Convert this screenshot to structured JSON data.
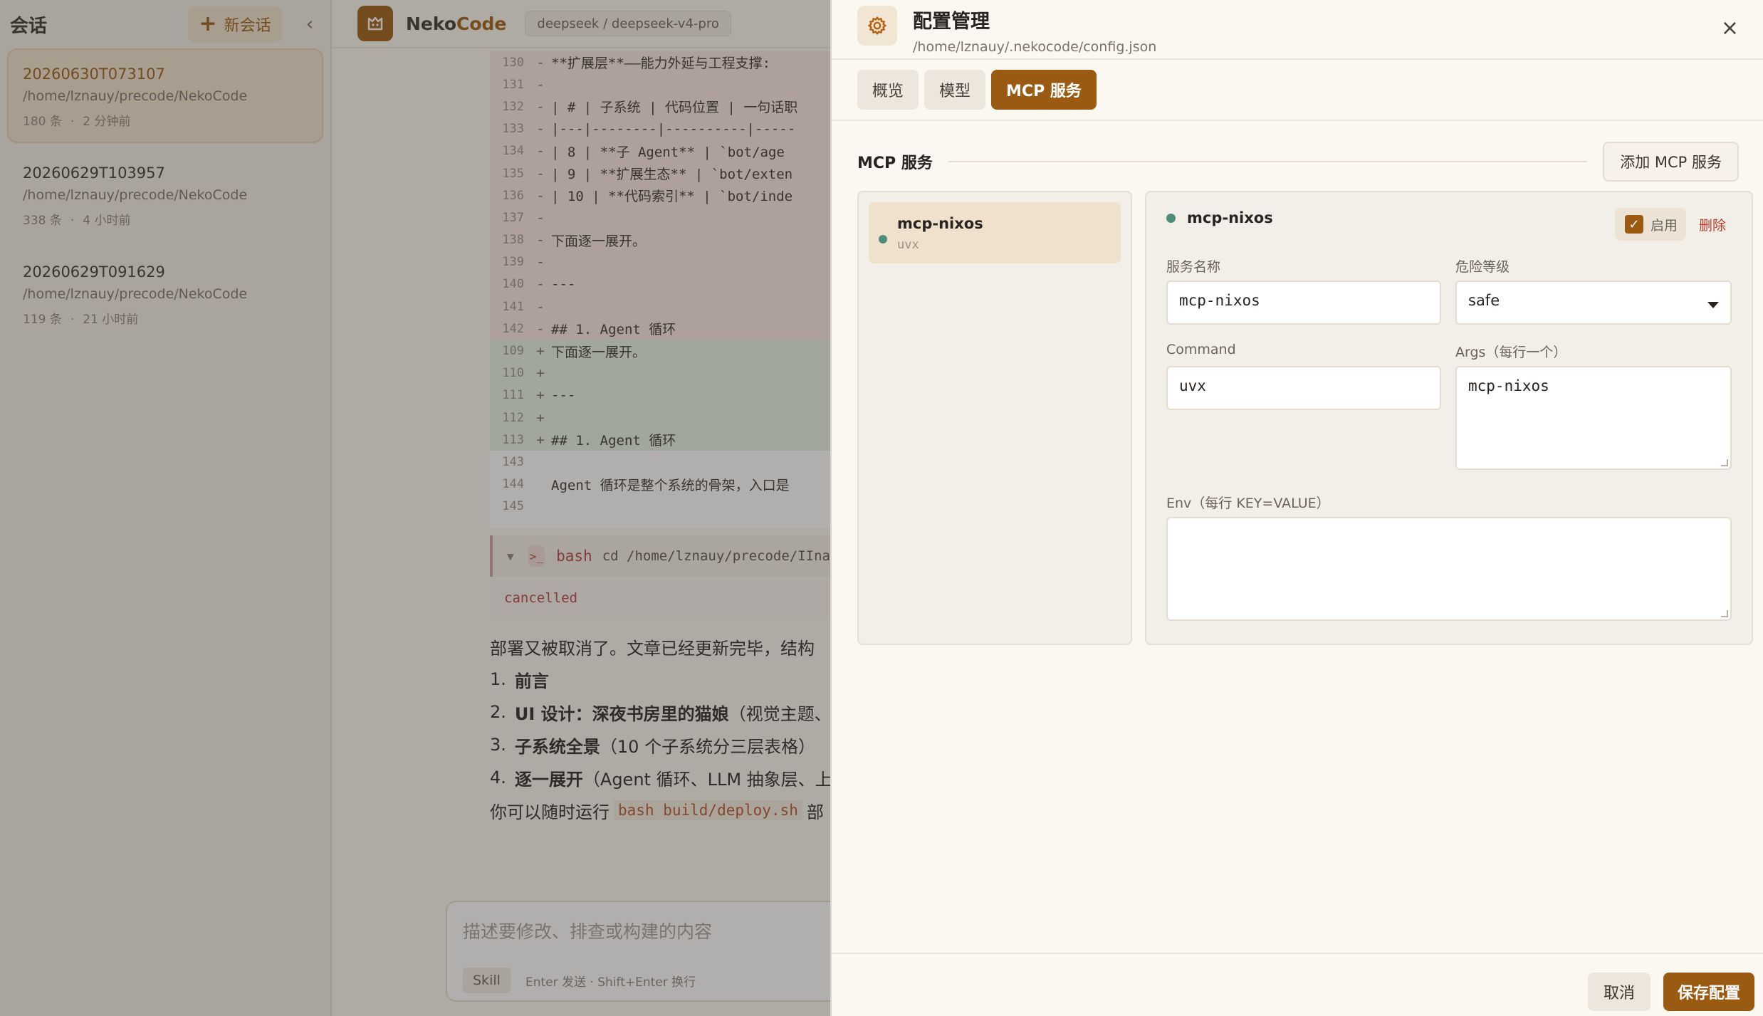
{
  "sidebar": {
    "title": "会话",
    "new_session_label": "新会话",
    "sessions": [
      {
        "name": "20260630T073107",
        "path": "/home/lznauy/precode/NekoCode",
        "count": "180 条",
        "time": "2 分钟前"
      },
      {
        "name": "20260629T103957",
        "path": "/home/lznauy/precode/NekoCode",
        "count": "338 条",
        "time": "4 小时前"
      },
      {
        "name": "20260629T091629",
        "path": "/home/lznauy/precode/NekoCode",
        "count": "119 条",
        "time": "21 小时前"
      }
    ]
  },
  "topbar": {
    "brand_a": "Neko",
    "brand_b": "Code",
    "model": "deepseek / deepseek-v4-pro"
  },
  "diff_lines": [
    {
      "ln": "130",
      "mk": "-",
      "tx": "**扩展层**——能力外延与工程支撑:",
      "kind": "del"
    },
    {
      "ln": "131",
      "mk": "-",
      "tx": "",
      "kind": "del"
    },
    {
      "ln": "132",
      "mk": "-",
      "tx": "| # | 子系统 | 代码位置 | 一句话职",
      "kind": "del"
    },
    {
      "ln": "133",
      "mk": "-",
      "tx": "|---|--------|----------|-----",
      "kind": "del"
    },
    {
      "ln": "134",
      "mk": "-",
      "tx": "| 8 | **子 Agent** | `bot/age",
      "kind": "del"
    },
    {
      "ln": "135",
      "mk": "-",
      "tx": "| 9 | **扩展生态** | `bot/exten",
      "kind": "del"
    },
    {
      "ln": "136",
      "mk": "-",
      "tx": "| 10 | **代码索引** | `bot/inde",
      "kind": "del"
    },
    {
      "ln": "137",
      "mk": "-",
      "tx": "",
      "kind": "del"
    },
    {
      "ln": "138",
      "mk": "-",
      "tx": "下面逐一展开。",
      "kind": "del"
    },
    {
      "ln": "139",
      "mk": "-",
      "tx": "",
      "kind": "del"
    },
    {
      "ln": "140",
      "mk": "-",
      "tx": "---",
      "kind": "del"
    },
    {
      "ln": "141",
      "mk": "-",
      "tx": "",
      "kind": "del"
    },
    {
      "ln": "142",
      "mk": "-",
      "tx": "## 1. Agent 循环",
      "kind": "del"
    },
    {
      "ln": "109",
      "mk": "+",
      "tx": "下面逐一展开。",
      "kind": "add"
    },
    {
      "ln": "110",
      "mk": "+",
      "tx": "",
      "kind": "add"
    },
    {
      "ln": "111",
      "mk": "+",
      "tx": "---",
      "kind": "add"
    },
    {
      "ln": "112",
      "mk": "+",
      "tx": "",
      "kind": "add"
    },
    {
      "ln": "113",
      "mk": "+",
      "tx": "## 1. Agent 循环",
      "kind": "add"
    },
    {
      "ln": "143",
      "mk": "",
      "tx": "",
      "kind": "ctx"
    },
    {
      "ln": "144",
      "mk": "",
      "tx": "Agent 循环是整个系统的骨架，入口是",
      "kind": "ctx"
    },
    {
      "ln": "145",
      "mk": "",
      "tx": "",
      "kind": "ctx"
    }
  ],
  "bash": {
    "name": "bash",
    "command": "cd /home/lznauy/precode/IIna",
    "output": "cancelled"
  },
  "prose": {
    "intro": "部署又被取消了。文章已经更新完毕，结构",
    "items": [
      {
        "num": "1.",
        "bold": "前言",
        "rest": ""
      },
      {
        "num": "2.",
        "bold": "UI 设计：深夜书房里的猫娘",
        "rest": "（视觉主题、"
      },
      {
        "num": "3.",
        "bold": "子系统全景",
        "rest": "（10 个子系统分三层表格）"
      },
      {
        "num": "4.",
        "bold": "逐一展开",
        "rest": "（Agent 循环、LLM 抽象层、上"
      }
    ],
    "outro_a": "你可以随时运行",
    "outro_code": "bash build/deploy.sh",
    "outro_b": "部"
  },
  "composer": {
    "placeholder": "描述要修改、排查或构建的内容",
    "skill_label": "Skill",
    "hint": "Enter 发送 · Shift+Enter 换行"
  },
  "config": {
    "title": "配置管理",
    "path": "/home/lznauy/.nekocode/config.json",
    "close": "×",
    "tabs": [
      "概览",
      "模型",
      "MCP 服务"
    ],
    "section_title": "MCP 服务",
    "add_label": "添加 MCP 服务",
    "servers": [
      {
        "name": "mcp-nixos",
        "cmd": "uvx"
      }
    ],
    "detail": {
      "name": "mcp-nixos",
      "enable_label": "启用",
      "enabled": true,
      "delete_label": "删除",
      "name_label": "服务名称",
      "name_value": "mcp-nixos",
      "level_label": "危险等级",
      "level_value": "safe",
      "command_label": "Command",
      "command_value": "uvx",
      "args_label": "Args（每行一个）",
      "args_value": "mcp-nixos",
      "env_label": "Env（每行 KEY=VALUE）",
      "env_value": ""
    },
    "cancel_label": "取消",
    "save_label": "保存配置"
  },
  "colors": {
    "accent": "#9a5a12",
    "status_dot": "#4e8d7a",
    "danger": "#c0392b"
  }
}
